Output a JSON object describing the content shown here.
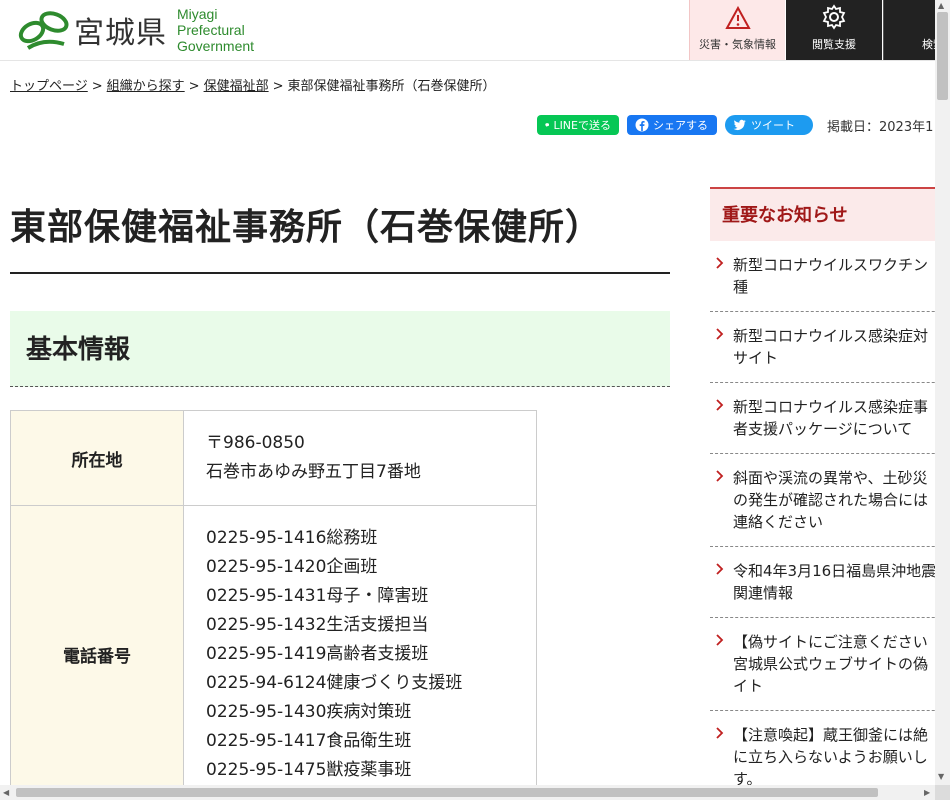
{
  "header": {
    "logo_ja": "宮城県",
    "logo_en": [
      "Miyagi",
      "Prefectural",
      "Government"
    ],
    "buttons": {
      "disaster": "災害・気象情報",
      "accessibility": "閲覧支援",
      "search": "検索メ"
    }
  },
  "breadcrumb": {
    "items": [
      "トップページ",
      "組織から探す",
      "保健福祉部"
    ],
    "current": "東部保健福祉事務所（石巻保健所）",
    "separator": ">"
  },
  "share": {
    "line": "LINEで送る",
    "facebook": "シェアする",
    "twitter": "ツイート",
    "posted": "掲載日：2023年1"
  },
  "main": {
    "title": "東部保健福祉事務所（石巻保健所）",
    "section": "基本情報",
    "table": {
      "address_label": "所在地",
      "address": [
        "〒986-0850",
        "石巻市あゆみ野五丁目7番地"
      ],
      "phone_label": "電話番号",
      "phones": [
        "0225-95-1416総務班",
        "0225-95-1420企画班",
        "0225-95-1431母子・障害班",
        "0225-95-1432生活支援担当",
        "0225-95-1419高齢者支援班",
        "0225-94-6124健康づくり支援班",
        "0225-95-1430疾病対策班",
        "0225-95-1417食品衛生班",
        "0225-95-1475獣疫薬事班"
      ]
    }
  },
  "sidebar": {
    "title": "重要なお知らせ",
    "items": [
      [
        "新型コロナウイルスワクチン",
        "種"
      ],
      [
        "新型コロナウイルス感染症対",
        "サイト"
      ],
      [
        "新型コロナウイルス感染症事",
        "者支援パッケージについて"
      ],
      [
        "斜面や渓流の異常や、土砂災",
        "の発生が確認された場合には",
        "連絡ください"
      ],
      [
        "令和4年3月16日福島県沖地震",
        "関連情報"
      ],
      [
        "【偽サイトにご注意ください",
        "宮城県公式ウェブサイトの偽",
        "イト"
      ],
      [
        "【注意喚起】蔵王御釜には絶",
        "に立ち入らないようお願いし",
        "す。"
      ]
    ]
  },
  "colors": {
    "logo_green": "#2e8b2e",
    "alert_red": "#c02020",
    "section_bg": "#e9fbe9",
    "table_header_bg": "#fdf9e8",
    "line_green": "#06c755",
    "facebook_blue": "#1877f2",
    "twitter_blue": "#1d9bf0"
  },
  "icons": {
    "disaster": "warning-triangle-icon",
    "accessibility": "gear-icon",
    "search": "search-menu-icon",
    "list_marker": "chevron-right-icon"
  }
}
